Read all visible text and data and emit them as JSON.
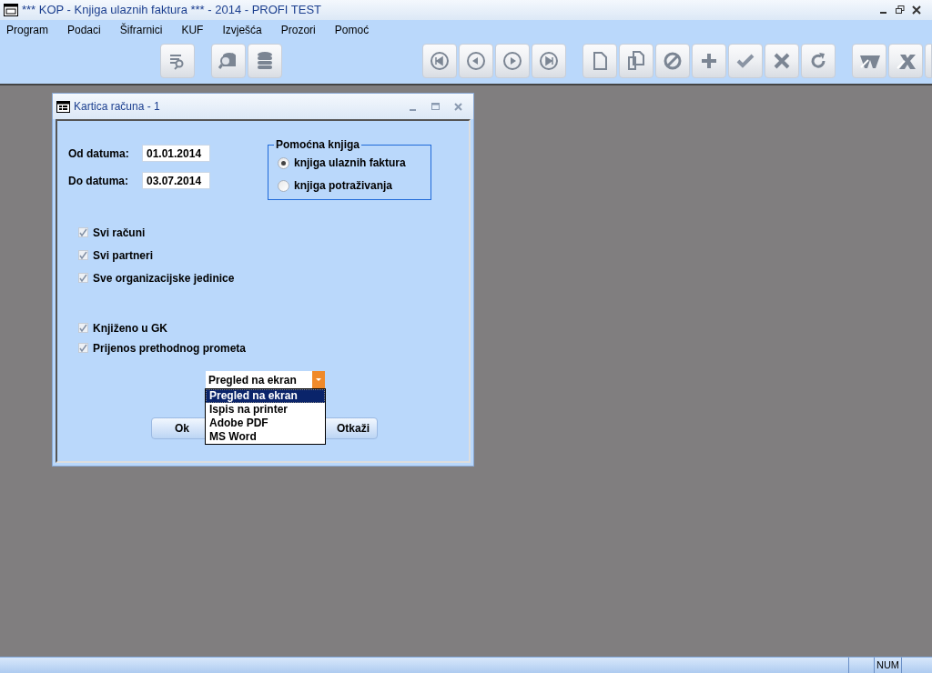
{
  "window": {
    "title": "*** KOP - Knjiga ulaznih faktura *** - 2014 - PROFI TEST"
  },
  "menu": [
    "Program",
    "Podaci",
    "Šifrarnici",
    "KUF",
    "Izvješća",
    "Prozori",
    "Pomoć"
  ],
  "dialog": {
    "title": "Kartica računa - 1",
    "dates": [
      {
        "label": "Od datuma:",
        "value": "01.01.2014"
      },
      {
        "label": "Do datuma:",
        "value": "03.07.2014"
      }
    ],
    "group": {
      "title": "Pomoćna knjiga",
      "options": [
        {
          "label": "knjiga ulaznih faktura",
          "selected": true
        },
        {
          "label": "knjiga potraživanja",
          "selected": false
        }
      ]
    },
    "checks_a": [
      {
        "label": "Svi računi",
        "checked": true
      },
      {
        "label": "Svi partneri",
        "checked": true
      },
      {
        "label": "Sve organizacijske jedinice",
        "checked": true
      }
    ],
    "checks_b": [
      {
        "label": "Knjiženo u GK",
        "checked": true
      },
      {
        "label": "Prijenos prethodnog prometa",
        "checked": true
      }
    ],
    "output": {
      "value": "Pregled na ekran",
      "options": [
        {
          "label": "Pregled na ekran",
          "selected": true
        },
        {
          "label": "Ispis na printer",
          "selected": false
        },
        {
          "label": "Adobe PDF",
          "selected": false
        },
        {
          "label": "MS Word",
          "selected": false
        }
      ]
    },
    "buttons": [
      "Ok",
      "Otkaži"
    ]
  },
  "status_bar": {
    "num": "NUM"
  }
}
